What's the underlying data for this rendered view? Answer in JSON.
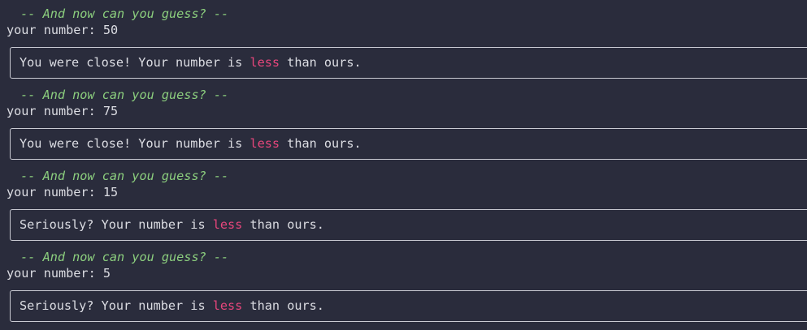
{
  "colors": {
    "background": "#2a2c3c",
    "text": "#dcdde3",
    "prompt": "#8ccf7e",
    "highlight": "#e8467c",
    "border": "#c9cad2"
  },
  "rounds": [
    {
      "prompt": " -- And now can you guess? --",
      "input_label": "your number: ",
      "input_value": "50",
      "feedback_before": "You were close! Your number is ",
      "feedback_highlight": "less",
      "feedback_after": " than ours."
    },
    {
      "prompt": " -- And now can you guess? --",
      "input_label": "your number: ",
      "input_value": "75",
      "feedback_before": "You were close! Your number is ",
      "feedback_highlight": "less",
      "feedback_after": " than ours."
    },
    {
      "prompt": " -- And now can you guess? --",
      "input_label": "your number: ",
      "input_value": "15",
      "feedback_before": "Seriously? Your number is ",
      "feedback_highlight": "less",
      "feedback_after": " than ours."
    },
    {
      "prompt": " -- And now can you guess? --",
      "input_label": "your number: ",
      "input_value": "5",
      "feedback_before": "Seriously? Your number is ",
      "feedback_highlight": "less",
      "feedback_after": " than ours."
    }
  ]
}
